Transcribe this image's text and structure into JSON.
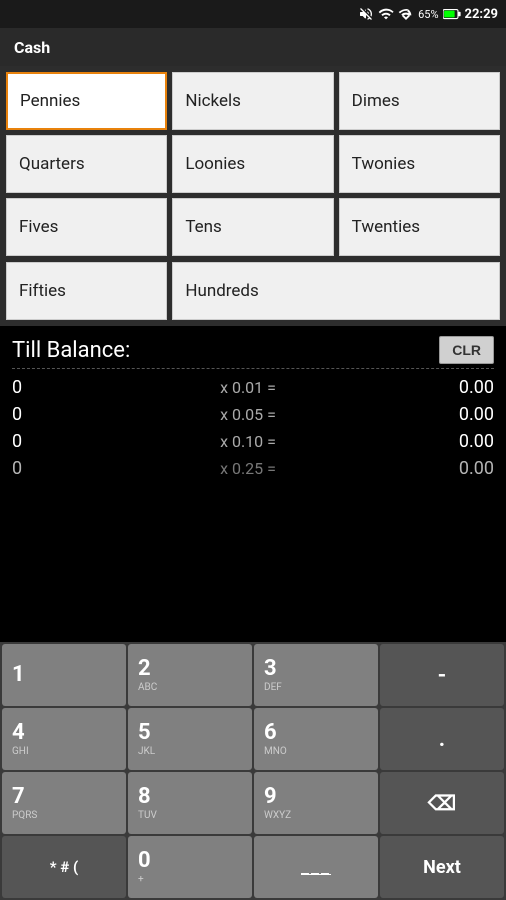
{
  "statusBar": {
    "time": "22:29",
    "battery": "65%"
  },
  "titleBar": {
    "title": "Cash"
  },
  "currencyGrid": {
    "rows": [
      [
        "Pennies",
        "Nickels",
        "Dimes"
      ],
      [
        "Quarters",
        "Loonies",
        "Twonies"
      ],
      [
        "Fives",
        "Tens",
        "Twenties"
      ]
    ],
    "bottomRow": [
      "Fifties",
      "Hundreds"
    ],
    "activeCell": "Pennies"
  },
  "balanceSection": {
    "title": "Till Balance:",
    "clrLabel": "CLR",
    "rows": [
      {
        "qty": "0",
        "multiplier": "x 0.01 =",
        "value": "0.00"
      },
      {
        "qty": "0",
        "multiplier": "x 0.05 =",
        "value": "0.00"
      },
      {
        "qty": "0",
        "multiplier": "x 0.10 =",
        "value": "0.00"
      },
      {
        "qty": "0",
        "multiplier": "x 0.25 =",
        "value": "0.00"
      }
    ]
  },
  "keypad": {
    "rows": [
      [
        {
          "main": "1",
          "sub": "",
          "type": "num"
        },
        {
          "main": "2",
          "sub": "ABC",
          "type": "num"
        },
        {
          "main": "3",
          "sub": "DEF",
          "type": "num"
        },
        {
          "main": "-",
          "sub": "",
          "type": "dark-symbol"
        }
      ],
      [
        {
          "main": "4",
          "sub": "GHI",
          "type": "num"
        },
        {
          "main": "5",
          "sub": "JKL",
          "type": "num"
        },
        {
          "main": "6",
          "sub": "MNO",
          "type": "num"
        },
        {
          "main": ".",
          "sub": "",
          "type": "dark-symbol"
        }
      ],
      [
        {
          "main": "7",
          "sub": "PQRS",
          "type": "num"
        },
        {
          "main": "8",
          "sub": "TUV",
          "type": "num"
        },
        {
          "main": "9",
          "sub": "WXYZ",
          "type": "num"
        },
        {
          "main": "⌫",
          "sub": "",
          "type": "dark-backspace"
        }
      ],
      [
        {
          "main": "* # (",
          "sub": "",
          "type": "misc"
        },
        {
          "main": "0",
          "sub": "+",
          "type": "num-plus"
        },
        {
          "main": "___",
          "sub": "",
          "type": "space"
        },
        {
          "main": "Next",
          "sub": "",
          "type": "dark-next"
        }
      ]
    ]
  }
}
